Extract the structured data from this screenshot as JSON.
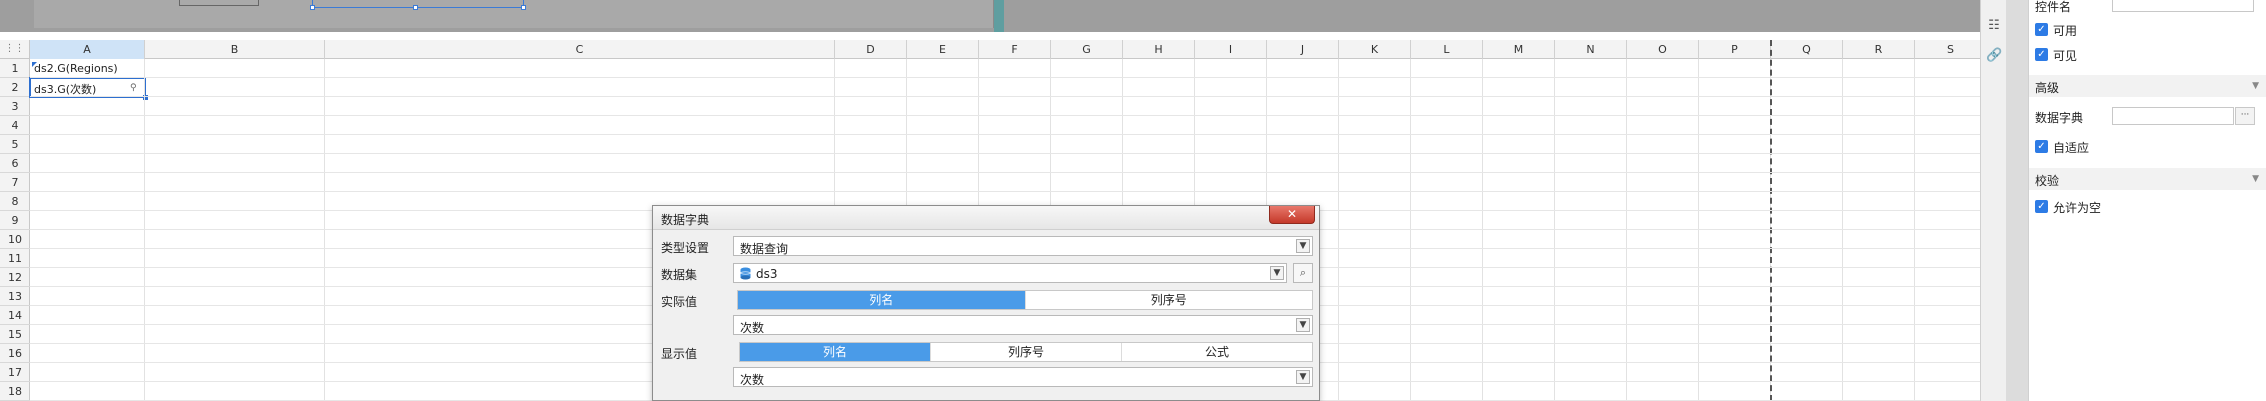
{
  "columns": [
    "A",
    "B",
    "C",
    "D",
    "E",
    "F",
    "G",
    "H",
    "I",
    "J",
    "K",
    "L",
    "M",
    "N",
    "O",
    "P",
    "Q",
    "R",
    "S"
  ],
  "rows": [
    "1",
    "2",
    "3",
    "4",
    "5",
    "6",
    "7",
    "8",
    "9",
    "10",
    "11",
    "12",
    "13",
    "14",
    "15",
    "16",
    "17",
    "18"
  ],
  "corner_icon": "grid-icon",
  "cells": {
    "a1": "ds2.G(Regions)",
    "a2": "ds3.G(次数)"
  },
  "dialog": {
    "title": "数据字典",
    "close_glyph": "✕",
    "type_label": "类型设置",
    "type_value": "数据查询",
    "dataset_label": "数据集",
    "dataset_value": "ds3",
    "actual_label": "实际值",
    "actual_tabs": [
      "列名",
      "列序号"
    ],
    "actual_active": 0,
    "actual_value": "次数",
    "display_label": "显示值",
    "display_tabs": [
      "列名",
      "列序号",
      "公式"
    ],
    "display_active": 0,
    "display_value": "次数"
  },
  "right_panel": {
    "control_name_label": "控件名",
    "checkbox_usable": "可用",
    "checkbox_visible": "可见",
    "section_advanced": "高级",
    "data_dict_label": "数据字典",
    "data_dict_button": "···",
    "checkbox_autofit": "自适应",
    "section_validation": "校验",
    "checkbox_allow_empty": "允许为空"
  },
  "colors": {
    "accent": "#4a9be8",
    "selection": "#2d6fd0",
    "checkbox": "#2d7be5",
    "close_button": "#c4392a"
  }
}
